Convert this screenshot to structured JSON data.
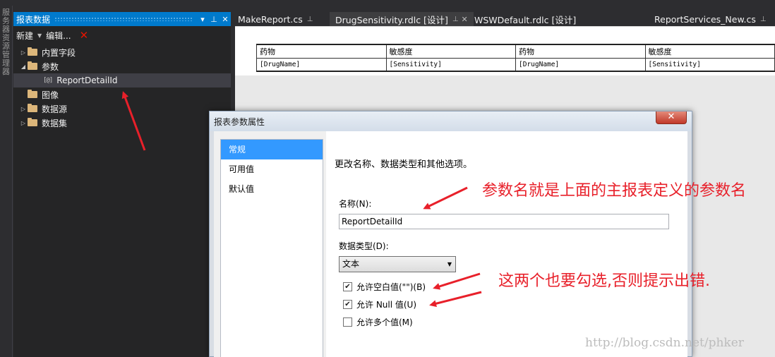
{
  "left_strip": {
    "text": "服务器资源管理器"
  },
  "panel": {
    "title": "报表数据",
    "toolbar": {
      "new_label": "新建",
      "edit_label": "编辑..."
    },
    "tree": {
      "builtin": "内置字段",
      "params": "参数",
      "param_item": "ReportDetailId",
      "images": "图像",
      "datasources": "数据源",
      "datasets": "数据集"
    }
  },
  "tabs": [
    {
      "label": "MakeReport.cs"
    },
    {
      "label": "DrugSensitivity.rdlc [设计]"
    },
    {
      "label": "WSWDefault.rdlc [设计]"
    },
    {
      "label": "ReportServices_New.cs"
    }
  ],
  "report_table": {
    "headers": [
      "药物",
      "敏感度",
      "药物",
      "敏感度"
    ],
    "fields": [
      "[DrugName]",
      "[Sensitivity]",
      "[DrugName]",
      "[Sensitivity]"
    ]
  },
  "dialog": {
    "title": "报表参数属性",
    "close": "✕",
    "nav": [
      "常规",
      "可用值",
      "默认值"
    ],
    "description": "更改名称、数据类型和其他选项。",
    "name_label": "名称(N):",
    "name_value": "ReportDetailId",
    "type_label": "数据类型(D):",
    "type_value": "文本",
    "checkboxes": [
      {
        "label": "允许空白值(\"\")(B)",
        "checked": true
      },
      {
        "label": "允许 Null 值(U)",
        "checked": true
      },
      {
        "label": "允许多个值(M)",
        "checked": false
      }
    ]
  },
  "annotations": {
    "note1": "参数名就是上面的主报表定义的参数名",
    "note2": "这两个也要勾选,否则提示出错."
  },
  "watermark": "http://blog.csdn.net/phker",
  "colors": {
    "accent": "#007acc",
    "annotation": "#e8202a",
    "selection": "#3399ff"
  }
}
